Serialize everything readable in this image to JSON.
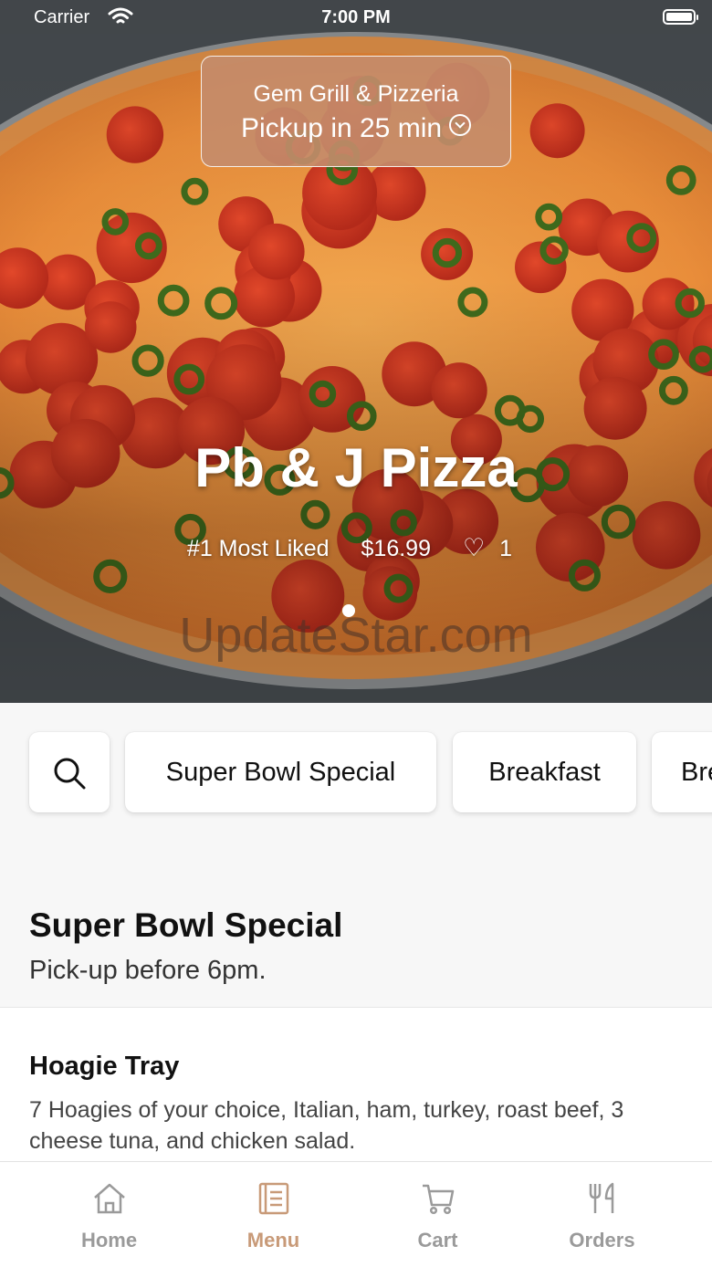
{
  "status_bar": {
    "carrier": "Carrier",
    "time": "7:00 PM"
  },
  "header": {
    "restaurant_name": "Gem Grill & Pizzeria",
    "pickup_label": "Pickup in 25 min",
    "chevron_icon": "chevron-down-circle-icon"
  },
  "featured": {
    "title": "Pb & J Pizza",
    "rank_label": "#1 Most Liked",
    "price": "$16.99",
    "likes": "1",
    "heart_icon": "heart-outline-icon",
    "page_index": 1,
    "page_count": 1
  },
  "watermark": "UpdateStar.com",
  "categories": {
    "search_icon": "search-icon",
    "items": [
      "Super Bowl Special",
      "Breakfast",
      "Breakfast"
    ]
  },
  "section": {
    "title": "Super Bowl Special",
    "subtitle": "Pick-up before 6pm."
  },
  "menu_items": [
    {
      "name": "Hoagie Tray",
      "description": "7 Hoagies of your choice, Italian, ham, turkey, roast beef, 3 cheese tuna, and chicken salad."
    }
  ],
  "tabbar": {
    "tabs": [
      {
        "label": "Home",
        "icon": "home-icon"
      },
      {
        "label": "Menu",
        "icon": "menu-book-icon"
      },
      {
        "label": "Cart",
        "icon": "cart-icon"
      },
      {
        "label": "Orders",
        "icon": "fork-knife-icon"
      }
    ],
    "active": "Menu"
  },
  "colors": {
    "accent": "#c89a78",
    "pill_background": "#c48c6c",
    "tab_inactive": "#9a9a9a",
    "page_background": "#f7f7f7"
  }
}
